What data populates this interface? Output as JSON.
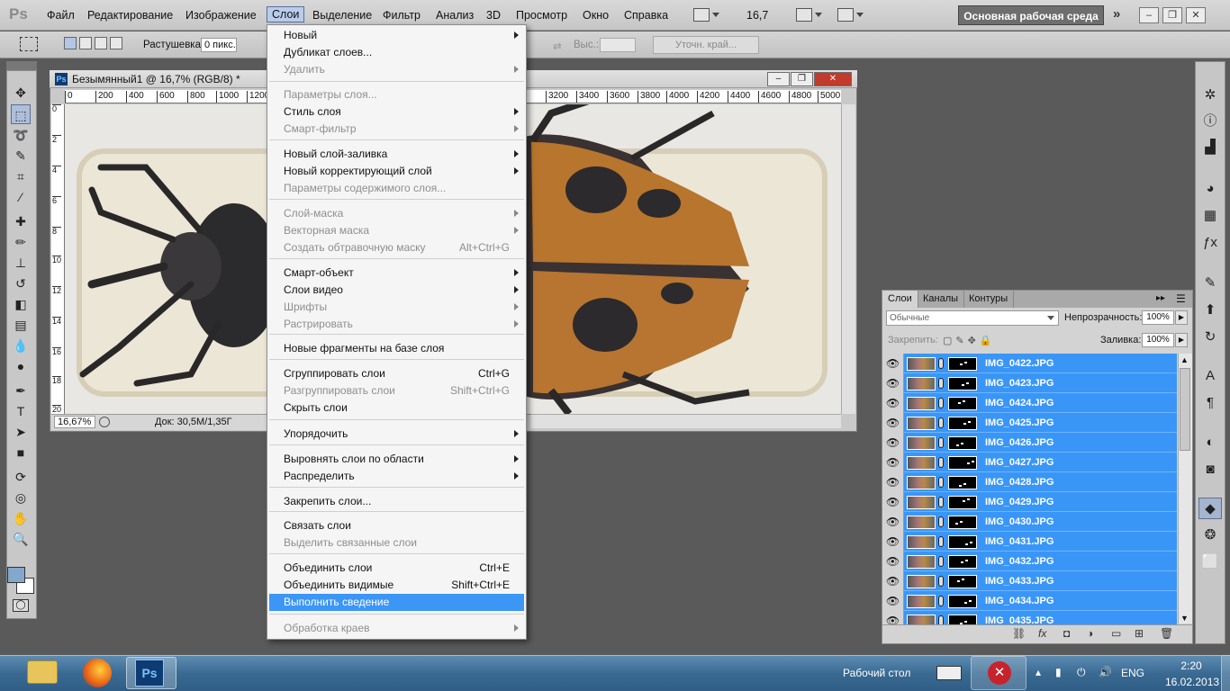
{
  "app": {
    "logo": "Ps",
    "menus": [
      "Файл",
      "Редактирование",
      "Изображение",
      "Слои",
      "Выделение",
      "Фильтр",
      "Анализ",
      "3D",
      "Просмотр",
      "Окно",
      "Справка"
    ],
    "active_menu": "Слои",
    "zoom_select": "16,7",
    "workspace": "Основная рабочая среда",
    "workspace_more": "»",
    "window_buttons": [
      "–",
      "❐",
      "✕"
    ]
  },
  "options_bar": {
    "feather_label": "Растушевка:",
    "feather_value": "0 пикс.",
    "height_label": "Выс.:",
    "refine_edge": "Уточн. край..."
  },
  "document": {
    "title": "Безымянный1 @ 16,7% (RGB/8) *",
    "icon": "Ps",
    "ruler_top": [
      "0",
      "200",
      "400",
      "600",
      "800",
      "1000",
      "1200",
      "3200",
      "3400",
      "3600",
      "3800",
      "4000",
      "4200",
      "4400",
      "4600",
      "4800",
      "5000"
    ],
    "ruler_left": [
      "0",
      "2",
      "4",
      "6",
      "8",
      "10",
      "12",
      "14",
      "16",
      "18",
      "20"
    ],
    "status_zoom": "16,67%",
    "status_doc": "Док: 30,5M/1,35Г",
    "status_arrow": "▶",
    "close_label": "✕",
    "min_label": "–",
    "max_label": "❐"
  },
  "layer_menu": {
    "items": [
      {
        "label": "Новый",
        "submenu": true
      },
      {
        "label": "Дубликат слоев..."
      },
      {
        "label": "Удалить",
        "submenu": true,
        "disabled": true
      },
      {
        "label": "Параметры слоя...",
        "disabled": true
      },
      {
        "label": "Стиль слоя",
        "submenu": true
      },
      {
        "label": "Смарт-фильтр",
        "submenu": true,
        "disabled": true
      },
      {
        "label": "Новый слой-заливка",
        "submenu": true
      },
      {
        "label": "Новый корректирующий слой",
        "submenu": true
      },
      {
        "label": "Параметры содержимого слоя...",
        "disabled": true
      },
      {
        "label": "Слой-маска",
        "submenu": true,
        "disabled": true
      },
      {
        "label": "Векторная маска",
        "submenu": true,
        "disabled": true
      },
      {
        "label": "Создать обтравочную маску",
        "shortcut": "Alt+Ctrl+G",
        "disabled": true
      },
      {
        "label": "Смарт-объект",
        "submenu": true
      },
      {
        "label": "Слои видео",
        "submenu": true
      },
      {
        "label": "Шрифты",
        "submenu": true,
        "disabled": true
      },
      {
        "label": "Растрировать",
        "submenu": true,
        "disabled": true
      },
      {
        "label": "Новые фрагменты на базе слоя"
      },
      {
        "label": "Сгруппировать слои",
        "shortcut": "Ctrl+G"
      },
      {
        "label": "Разгруппировать слои",
        "shortcut": "Shift+Ctrl+G",
        "disabled": true
      },
      {
        "label": "Скрыть слои"
      },
      {
        "label": "Упорядочить",
        "submenu": true
      },
      {
        "label": "Выровнять слои по области",
        "submenu": true
      },
      {
        "label": "Распределить",
        "submenu": true
      },
      {
        "label": "Закрепить слои..."
      },
      {
        "label": "Связать слои"
      },
      {
        "label": "Выделить связанные слои",
        "disabled": true
      },
      {
        "label": "Объединить слои",
        "shortcut": "Ctrl+E"
      },
      {
        "label": "Объединить видимые",
        "shortcut": "Shift+Ctrl+E"
      },
      {
        "label": "Выполнить сведение",
        "highlighted": true
      },
      {
        "label": "Обработка краев",
        "submenu": true,
        "disabled": true
      }
    ]
  },
  "layers_panel": {
    "tabs": [
      "Слои",
      "Каналы",
      "Контуры"
    ],
    "active_tab": "Слои",
    "blend_mode": "Обычные",
    "opacity_label": "Непрозрачность:",
    "opacity_value": "100%",
    "lock_label": "Закрепить:",
    "fill_label": "Заливка:",
    "fill_value": "100%",
    "layers": [
      "IMG_0422.JPG",
      "IMG_0423.JPG",
      "IMG_0424.JPG",
      "IMG_0425.JPG",
      "IMG_0426.JPG",
      "IMG_0427.JPG",
      "IMG_0428.JPG",
      "IMG_0429.JPG",
      "IMG_0430.JPG",
      "IMG_0431.JPG",
      "IMG_0432.JPG",
      "IMG_0433.JPG",
      "IMG_0434.JPG",
      "IMG_0435.JPG"
    ]
  },
  "taskbar": {
    "desktop_label": "Рабочий стол",
    "language": "ENG",
    "time": "2:20",
    "date": "16.02.2013",
    "ps_label": "Ps"
  },
  "colors": {
    "menu_highlight": "#3c96f5",
    "layer_selected": "#3a96f6",
    "foreground": "#82a8cb",
    "background": "#ffffff"
  }
}
